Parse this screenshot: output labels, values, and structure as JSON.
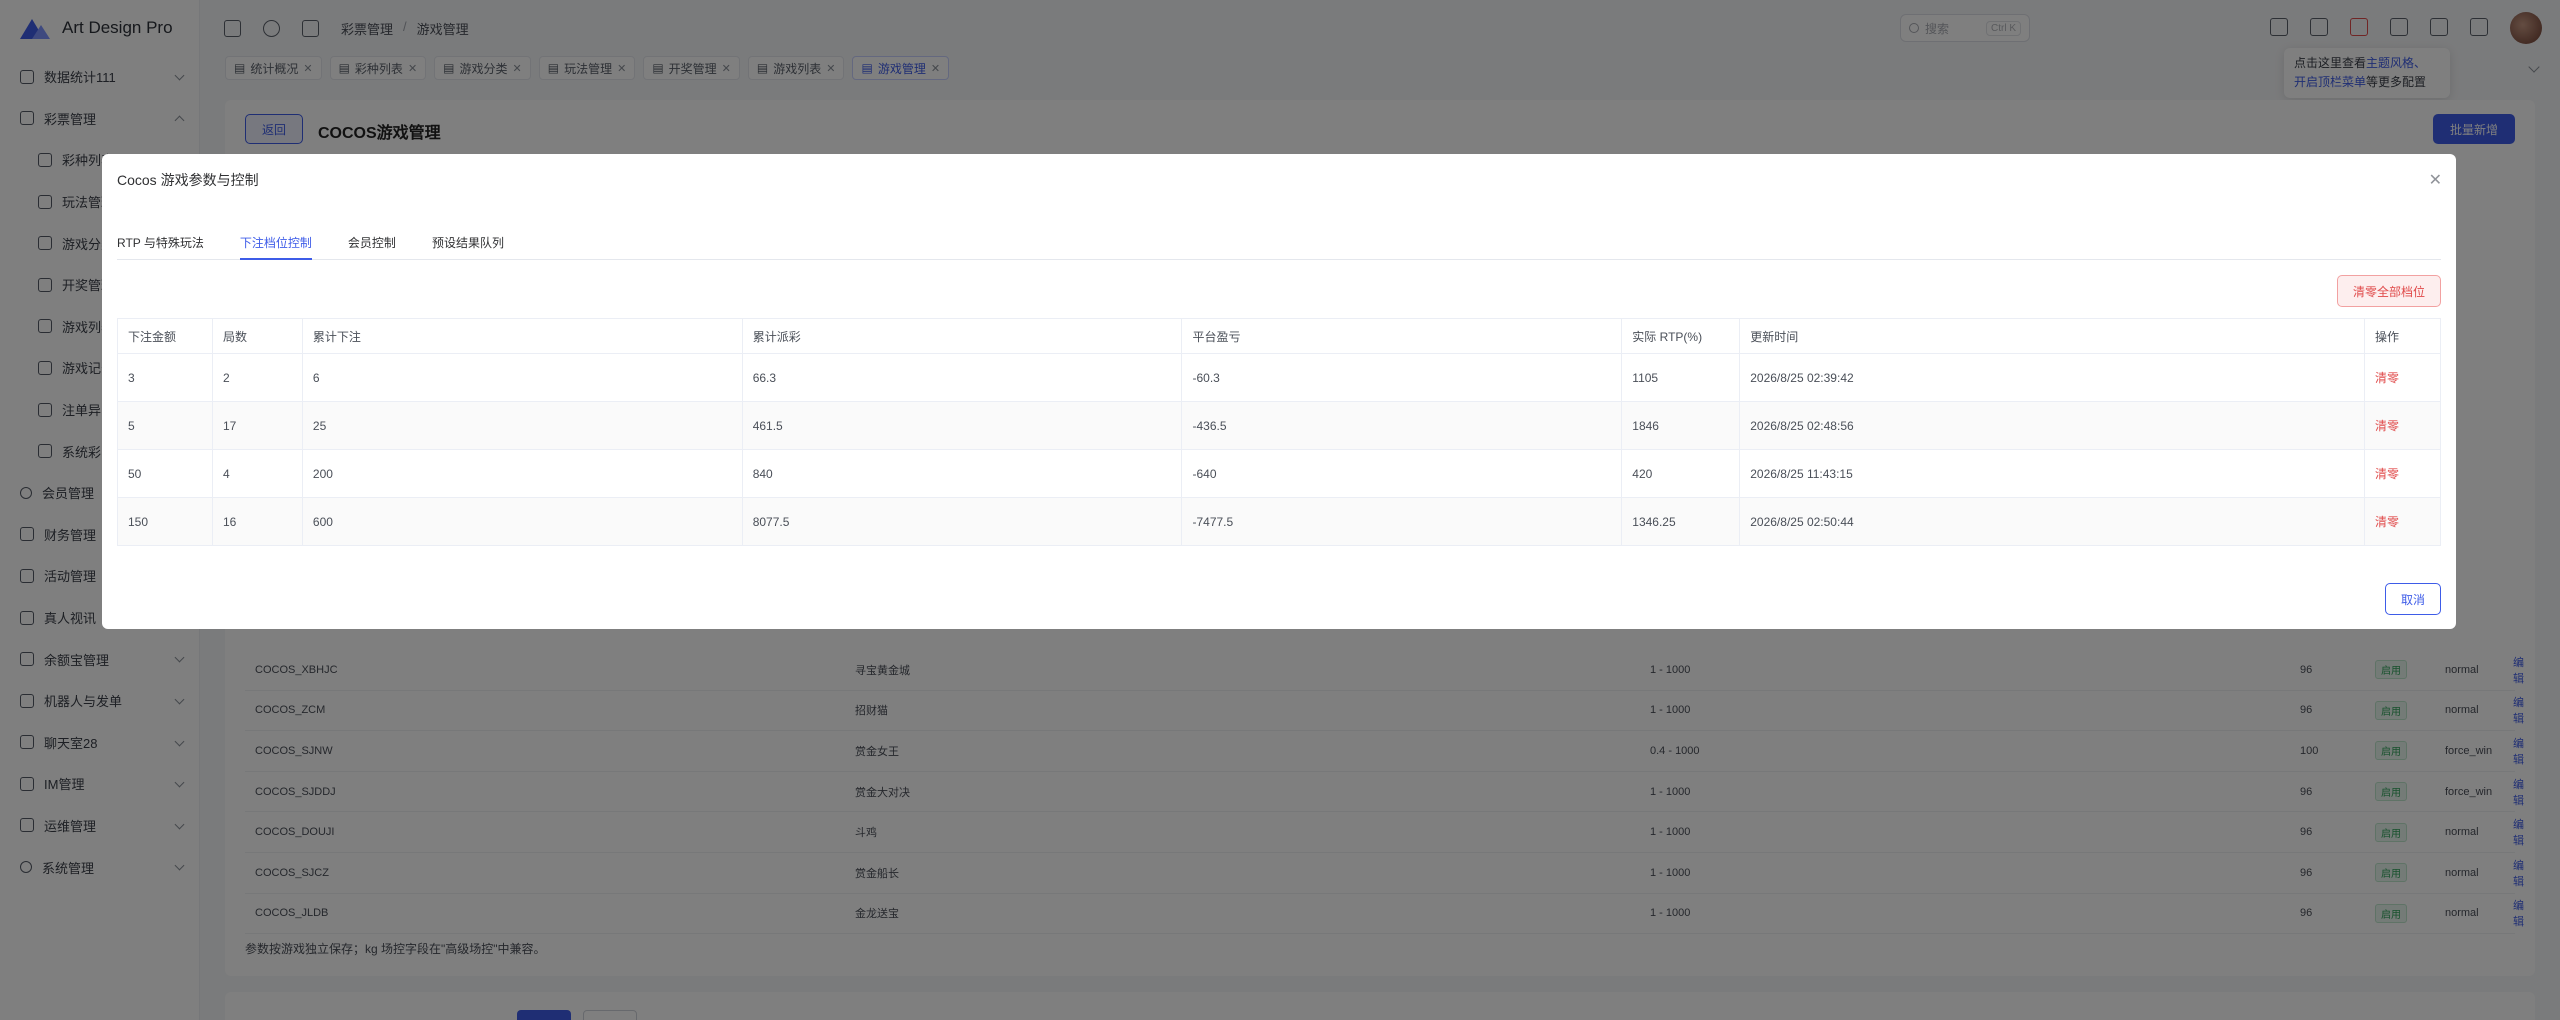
{
  "app": {
    "name": "Art Design Pro"
  },
  "sidebar": {
    "items": [
      {
        "label": "数据统计111",
        "sub": false,
        "chevron": "down"
      },
      {
        "label": "彩票管理",
        "sub": false,
        "chevron": "up"
      },
      {
        "label": "彩种列表",
        "sub": true
      },
      {
        "label": "玩法管理",
        "sub": true
      },
      {
        "label": "游戏分类",
        "sub": true
      },
      {
        "label": "开奖管理",
        "sub": true
      },
      {
        "label": "游戏列表",
        "sub": true
      },
      {
        "label": "游戏记录",
        "sub": true
      },
      {
        "label": "注单异常",
        "sub": true
      },
      {
        "label": "系统彩",
        "sub": true
      },
      {
        "label": "会员管理",
        "sub": false,
        "chevron": "down"
      },
      {
        "label": "财务管理",
        "sub": false,
        "chevron": "down"
      },
      {
        "label": "活动管理",
        "sub": false,
        "chevron": "down"
      },
      {
        "label": "真人视讯",
        "sub": false,
        "chevron": "down"
      },
      {
        "label": "余额宝管理",
        "sub": false,
        "chevron": "down"
      },
      {
        "label": "机器人与发单",
        "sub": false,
        "chevron": "down"
      },
      {
        "label": "聊天室28",
        "sub": false,
        "chevron": "down"
      },
      {
        "label": "IM管理",
        "sub": false,
        "chevron": "down"
      },
      {
        "label": "运维管理",
        "sub": false,
        "chevron": "down"
      },
      {
        "label": "系统管理",
        "sub": false,
        "chevron": "down"
      }
    ]
  },
  "header": {
    "breadcrumb": [
      "彩票管理",
      "游戏管理"
    ],
    "search_placeholder": "搜索",
    "search_shortcut": "Ctrl K"
  },
  "page_tabs": [
    {
      "label": "统计概况",
      "active": false
    },
    {
      "label": "彩种列表",
      "active": false
    },
    {
      "label": "游戏分类",
      "active": false
    },
    {
      "label": "玩法管理",
      "active": false
    },
    {
      "label": "开奖管理",
      "active": false
    },
    {
      "label": "游戏列表",
      "active": false
    },
    {
      "label": "游戏管理",
      "active": true
    }
  ],
  "tip": {
    "line1_prefix": "点击这里查看",
    "line1_link": "主题风格、",
    "line2_link": "开启顶栏菜单",
    "line2_suffix": "等更多配置"
  },
  "page": {
    "back_label": "返回",
    "title": "COCOS游戏管理",
    "batch_add_label": "批量新增",
    "bg_rows": [
      {
        "code": "COCOS_XBHJC",
        "name": "寻宝黄金城",
        "range": "1 - 1000",
        "rtp": "96",
        "status": "启用",
        "mode": "normal",
        "edit": "编辑"
      },
      {
        "code": "COCOS_ZCM",
        "name": "招财猫",
        "range": "1 - 1000",
        "rtp": "96",
        "status": "启用",
        "mode": "normal",
        "edit": "编辑"
      },
      {
        "code": "COCOS_SJNW",
        "name": "赏金女王",
        "range": "0.4 - 1000",
        "rtp": "100",
        "status": "启用",
        "mode": "force_win",
        "edit": "编辑"
      },
      {
        "code": "COCOS_SJDDJ",
        "name": "赏金大对决",
        "range": "1 - 1000",
        "rtp": "96",
        "status": "启用",
        "mode": "force_win",
        "edit": "编辑"
      },
      {
        "code": "COCOS_DOUJI",
        "name": "斗鸡",
        "range": "1 - 1000",
        "rtp": "96",
        "status": "启用",
        "mode": "normal",
        "edit": "编辑"
      },
      {
        "code": "COCOS_SJCZ",
        "name": "赏金船长",
        "range": "1 - 1000",
        "rtp": "96",
        "status": "启用",
        "mode": "normal",
        "edit": "编辑"
      },
      {
        "code": "COCOS_JLDB",
        "name": "金龙送宝",
        "range": "1 - 1000",
        "rtp": "96",
        "status": "启用",
        "mode": "normal",
        "edit": "编辑"
      }
    ],
    "footnote": "参数按游戏独立保存；kg 场控字段在\"高级场控\"中兼容。"
  },
  "dialog": {
    "title": "Cocos 游戏参数与控制",
    "tabs": [
      {
        "label": "RTP 与特殊玩法",
        "active": false
      },
      {
        "label": "下注档位控制",
        "active": true
      },
      {
        "label": "会员控制",
        "active": false
      },
      {
        "label": "预设结果队列",
        "active": false
      }
    ],
    "clear_all_label": "清零全部档位",
    "table": {
      "headers": [
        "下注金额",
        "局数",
        "累计下注",
        "累计派彩",
        "平台盈亏",
        "实际 RTP(%)",
        "更新时间",
        "操作"
      ],
      "rows": [
        [
          "3",
          "2",
          "6",
          "66.3",
          "-60.3",
          "1105",
          "2026/8/25 02:39:42",
          "清零"
        ],
        [
          "5",
          "17",
          "25",
          "461.5",
          "-436.5",
          "1846",
          "2026/8/25 02:48:56",
          "清零"
        ],
        [
          "50",
          "4",
          "200",
          "840",
          "-640",
          "420",
          "2026/8/25 11:43:15",
          "清零"
        ],
        [
          "150",
          "16",
          "600",
          "8077.5",
          "-7477.5",
          "1346.25",
          "2026/8/25 02:50:44",
          "清零"
        ]
      ]
    },
    "cancel_label": "取消"
  },
  "colors": {
    "accent": "#3e5ce8",
    "danger": "#e04a4a",
    "success": "#2fa35a"
  }
}
